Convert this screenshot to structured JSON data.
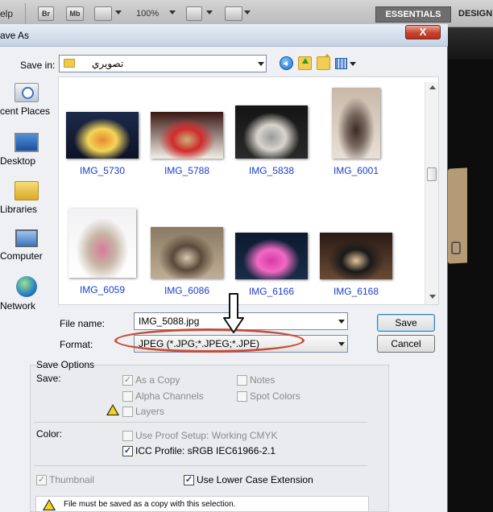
{
  "app_bar": {
    "menu_help": "elp",
    "br_label": "Br",
    "mb_label": "Mb",
    "zoom": "100%",
    "essentials": "ESSENTIALS",
    "design": "DESIGN"
  },
  "dialog": {
    "title": "ave As",
    "close_label": "X",
    "save_in_label": "Save in:",
    "save_in_value": "تصويري",
    "places": [
      {
        "label": "cent Places",
        "icon": "recent-places-icon"
      },
      {
        "label": "Desktop",
        "icon": "desktop-icon"
      },
      {
        "label": "Libraries",
        "icon": "libraries-icon"
      },
      {
        "label": "Computer",
        "icon": "computer-icon"
      },
      {
        "label": "Network",
        "icon": "network-icon"
      }
    ],
    "files": [
      {
        "name": "IMG_5730",
        "colors": [
          "#1c2a4a",
          "#e88a2c",
          "#f4d55a",
          "#0d1326"
        ]
      },
      {
        "name": "IMG_5788",
        "colors": [
          "#3a1612",
          "#c8b27a",
          "#d12b2b",
          "#f2efe6"
        ]
      },
      {
        "name": "IMG_5838",
        "colors": [
          "#141414",
          "#9a9a9a",
          "#d8d4cc",
          "#2a2a2a"
        ]
      },
      {
        "name": "IMG_6001",
        "colors": [
          "#c9b8a8",
          "#3a2a24",
          "#7a6a62",
          "#e9e0d6"
        ]
      },
      {
        "name": "IMG_6059",
        "colors": [
          "#f2f2f4",
          "#d87a9a",
          "#c7b6a6",
          "#ffffff"
        ]
      },
      {
        "name": "IMG_6086",
        "colors": [
          "#8a7a64",
          "#d8c8b0",
          "#5a4a3a",
          "#bfae94"
        ]
      },
      {
        "name": "IMG_6166",
        "colors": [
          "#0c1a30",
          "#d83aa4",
          "#f06ac4",
          "#1a2c48"
        ]
      },
      {
        "name": "IMG_6168",
        "colors": [
          "#2a1a14",
          "#e8c49a",
          "#1a1a1a",
          "#6a4a34"
        ]
      }
    ],
    "file_name_label": "File name:",
    "file_name_value": "IMG_5088.jpg",
    "format_label": "Format:",
    "format_value": "JPEG (*.JPG;*.JPEG;*.JPE)",
    "save_button": "Save",
    "cancel_button": "Cancel",
    "highlight_color": "#c84c38"
  },
  "save_options": {
    "title": "Save Options",
    "save_label": "Save:",
    "as_copy": {
      "label": "As a Copy",
      "checked": true,
      "enabled": false
    },
    "notes": {
      "label": "Notes",
      "checked": false,
      "enabled": false
    },
    "alpha_channels": {
      "label": "Alpha Channels",
      "checked": false,
      "enabled": false
    },
    "spot_colors": {
      "label": "Spot Colors",
      "checked": false,
      "enabled": false
    },
    "layers": {
      "label": "Layers",
      "checked": false,
      "enabled": false
    },
    "color_label": "Color:",
    "use_proof_setup": {
      "label": "Use Proof Setup:  Working CMYK",
      "checked": false,
      "enabled": false
    },
    "icc_profile": {
      "label": "ICC Profile:  sRGB IEC61966-2.1",
      "checked": true,
      "enabled": true
    },
    "thumbnail": {
      "label": "Thumbnail",
      "checked": true,
      "enabled": false
    },
    "lower_case_ext": {
      "label": "Use Lower Case Extension",
      "checked": true,
      "enabled": true
    },
    "warning": "File must be saved as a copy with this selection."
  }
}
